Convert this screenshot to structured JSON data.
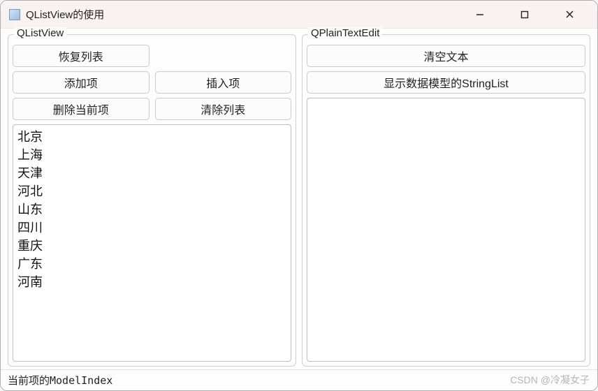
{
  "window": {
    "title": "QListView的使用"
  },
  "left_group": {
    "title": "QListView",
    "buttons": {
      "restore": "恢复列表",
      "add": "添加项",
      "insert": "插入项",
      "delete": "删除当前项",
      "clear": "清除列表"
    },
    "items": [
      "北京",
      "上海",
      "天津",
      "河北",
      "山东",
      "四川",
      "重庆",
      "广东",
      "河南"
    ]
  },
  "right_group": {
    "title": "QPlainTextEdit",
    "buttons": {
      "clear_text": "清空文本",
      "show_stringlist": "显示数据模型的StringList"
    },
    "text": ""
  },
  "statusbar": {
    "text": "当前项的ModelIndex"
  },
  "watermark": "CSDN @冷凝女子"
}
